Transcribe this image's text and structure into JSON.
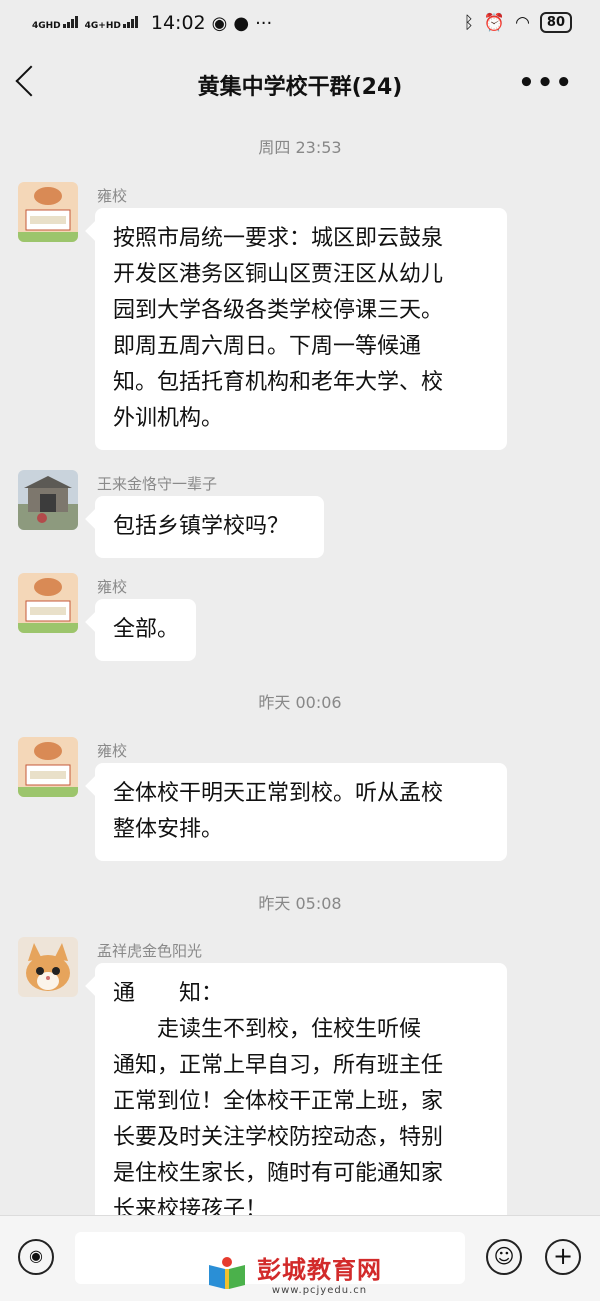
{
  "status_bar": {
    "network1": "4GHD",
    "network2": "4G+HD",
    "time": "14:02",
    "battery": "80",
    "icons": [
      "location-icon",
      "chat-icon",
      "bluetooth-icon",
      "alarm-icon",
      "wifi-icon",
      "battery-icon"
    ]
  },
  "header": {
    "title": "黄集中学校干群(24)",
    "back_icon": "back-arrow-icon",
    "more_label": "•••"
  },
  "messages": {
    "time1": "周四 23:53",
    "time2": "昨天 00:06",
    "time3": "昨天 05:08",
    "m1": {
      "sender": "雍校",
      "lines": [
        "按照市局统一要求：城区即云鼓泉",
        "开发区港务区铜山区贾汪区从幼儿",
        "园到大学各级各类学校停课三天。",
        "即周五周六周日。下周一等候通",
        "知。包括托育机构和老年大学、校",
        "外训机构。"
      ]
    },
    "m2": {
      "sender": "王来金恪守一辈子",
      "text": "包括乡镇学校吗？"
    },
    "m3": {
      "sender": "雍校",
      "text": "全部。"
    },
    "m4": {
      "sender": "雍校",
      "lines": [
        "全体校干明天正常到校。听从孟校",
        "整体安排。"
      ]
    },
    "m5": {
      "sender": "孟祥虎金色阳光",
      "lines": [
        "通　　知：",
        "　　走读生不到校，住校生听候",
        "通知，正常上早自习，所有班主任",
        "正常到位！全体校干正常上班，家",
        "长要及时关注学校防控动态，特别",
        "是住校生家长，随时有可能通知家",
        "长来校接孩子！"
      ]
    }
  },
  "input_bar": {
    "voice_icon": "voice-icon",
    "emoji_icon": "emoji-icon",
    "plus_label": "+"
  },
  "watermark": {
    "text": "彭城教育网",
    "url": "www.pcjyedu.cn"
  },
  "colors": {
    "background": "#ededed",
    "bubble": "#ffffff",
    "watermark": "#d22a2a"
  }
}
